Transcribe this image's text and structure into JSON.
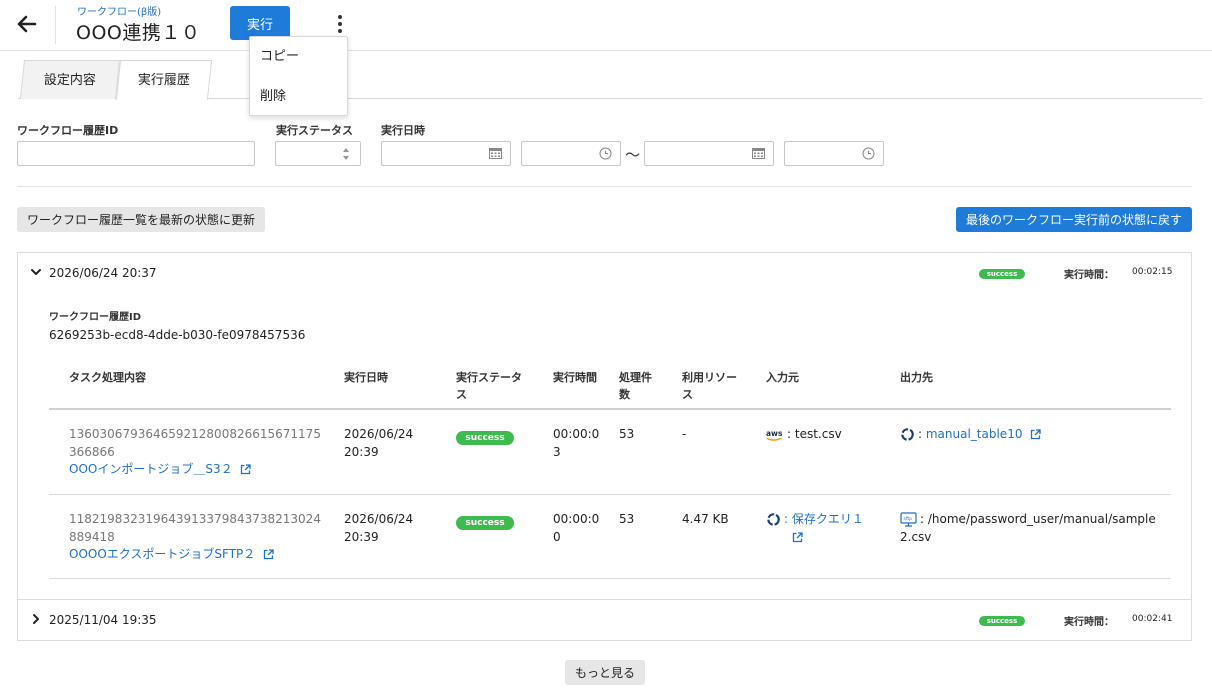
{
  "header": {
    "breadcrumb": "ワークフロー(β版)",
    "title": "OOO連携１０",
    "run_label": "実行"
  },
  "menu": {
    "copy": "コピー",
    "delete": "削除"
  },
  "tabs": [
    {
      "label": "設定内容",
      "active": false
    },
    {
      "label": "実行履歴",
      "active": true
    }
  ],
  "filters": {
    "history_id_label": "ワークフロー履歴ID",
    "status_label": "実行ステータス",
    "datetime_label": "実行日時",
    "range_separator": "〜"
  },
  "actions": {
    "refresh": "ワークフロー履歴一覧を最新の状態に更新",
    "revert": "最後のワークフロー実行前の状態に戻す",
    "load_more": "もっと見る"
  },
  "runs": [
    {
      "datetime": "2026/06/24 20:37",
      "status": "success",
      "duration_label": "実行時間：",
      "duration": "00:02:15",
      "expanded": true,
      "history_id_label": "ワークフロー履歴ID",
      "history_id": "6269253b-ecd8-4dde-b030-fe0978457536"
    },
    {
      "datetime": "2025/11/04 19:35",
      "status": "success",
      "duration_label": "実行時間：",
      "duration": "00:02:41",
      "expanded": false
    }
  ],
  "task_table": {
    "headers": [
      "タスク処理内容",
      "実行日時",
      "実行ステータス",
      "実行時間",
      "処理件数",
      "利用リソース",
      "入力元",
      "出力先"
    ],
    "rows": [
      {
        "task_id": "136030679364659212800826615671175366866",
        "task_name": "OOOインポートジョブ＿S3２",
        "datetime_date": "2026/06/24",
        "datetime_time": "20:39",
        "status": "success",
        "duration": "00:00:03",
        "count": "53",
        "resource": "-",
        "input_icon": "aws-icon",
        "input": ": test.csv",
        "output_icon": "database-icon",
        "output": "manual_table10"
      },
      {
        "task_id": "118219832319643913379843738213024889418",
        "task_name": "OOOOエクスポートジョブSFTP２",
        "datetime_date": "2026/06/24",
        "datetime_time": "20:39",
        "status": "success",
        "duration": "00:00:00",
        "count": "53",
        "resource": "4.47 KB",
        "input_icon": "database-icon",
        "input": "保存クエリ１",
        "output_icon": "sftp-server-icon",
        "output": ": /home/password_user/manual/sample2.csv"
      }
    ]
  },
  "colors": {
    "primary": "#1f7bd9",
    "link": "#1f6fc9",
    "success": "#3dbb4e"
  }
}
